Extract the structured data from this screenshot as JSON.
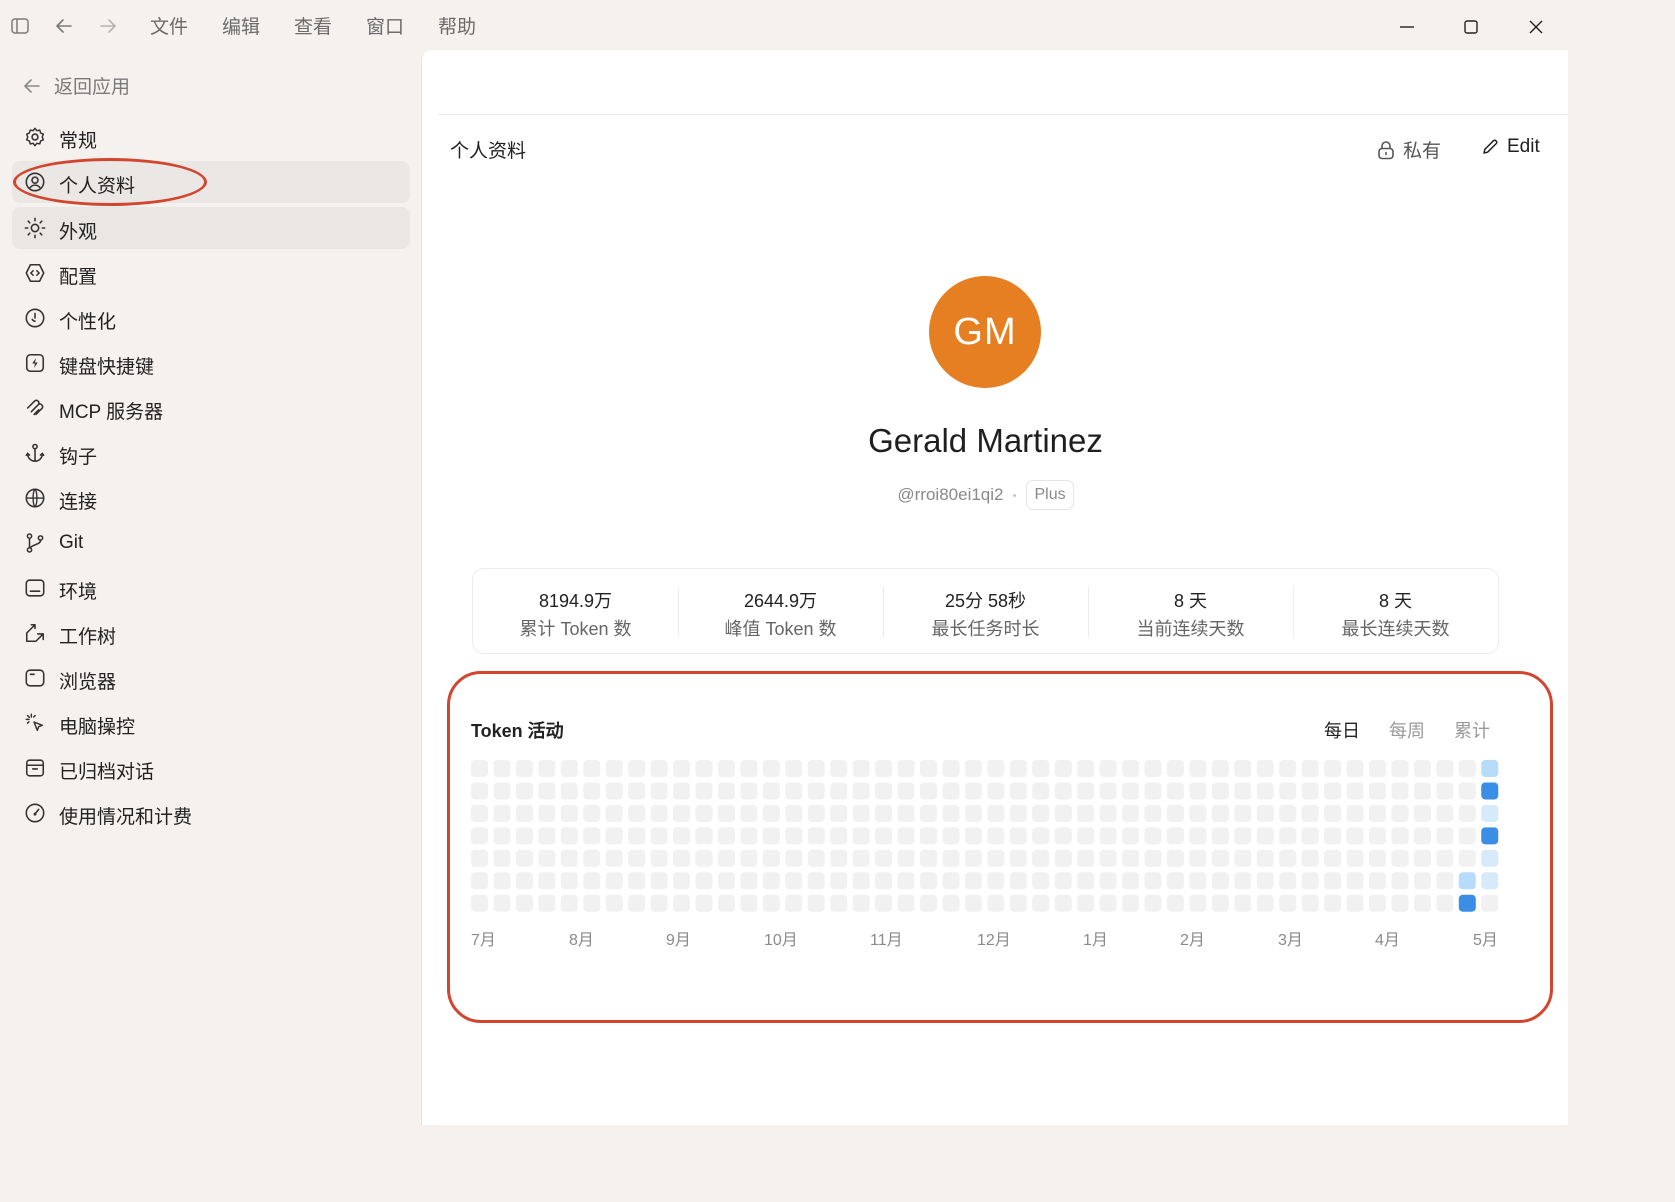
{
  "menu": [
    "文件",
    "编辑",
    "查看",
    "窗口",
    "帮助"
  ],
  "sidebar": {
    "back_label": "返回应用",
    "items": [
      {
        "label": "常规",
        "icon": "gear-icon"
      },
      {
        "label": "个人资料",
        "icon": "user-circle-icon"
      },
      {
        "label": "外观",
        "icon": "sun-icon"
      },
      {
        "label": "配置",
        "icon": "shield-code-icon"
      },
      {
        "label": "个性化",
        "icon": "smile-icon"
      },
      {
        "label": "键盘快捷键",
        "icon": "bolt-square-icon"
      },
      {
        "label": "MCP 服务器",
        "icon": "mcp-icon"
      },
      {
        "label": "钩子",
        "icon": "anchor-icon"
      },
      {
        "label": "连接",
        "icon": "globe-icon"
      },
      {
        "label": "Git",
        "icon": "git-branch-icon"
      },
      {
        "label": "环境",
        "icon": "monitor-icon"
      },
      {
        "label": "工作树",
        "icon": "worktree-icon"
      },
      {
        "label": "浏览器",
        "icon": "browser-icon"
      },
      {
        "label": "电脑操控",
        "icon": "cursor-click-icon"
      },
      {
        "label": "已归档对话",
        "icon": "archive-icon"
      },
      {
        "label": "使用情况和计费",
        "icon": "gauge-icon"
      }
    ]
  },
  "page": {
    "title": "个人资料",
    "private_label": "私有",
    "edit_label": "Edit"
  },
  "profile": {
    "initials": "GM",
    "name": "Gerald Martinez",
    "handle": "@rroi80ei1qi2",
    "plan": "Plus",
    "avatar_color": "#e67e22"
  },
  "stats": [
    {
      "value": "8194.9万",
      "label": "累计 Token 数"
    },
    {
      "value": "2644.9万",
      "label": "峰值 Token 数"
    },
    {
      "value": "25分 58秒",
      "label": "最长任务时长"
    },
    {
      "value": "8 天",
      "label": "当前连续天数"
    },
    {
      "value": "8 天",
      "label": "最长连续天数"
    }
  ],
  "activity": {
    "title": "Token 活动",
    "tabs": [
      {
        "label": "每日",
        "active": true
      },
      {
        "label": "每周",
        "active": false
      },
      {
        "label": "累计",
        "active": false
      }
    ],
    "months": [
      "7月",
      "8月",
      "9月",
      "10月",
      "11月",
      "12月",
      "1月",
      "2月",
      "3月",
      "4月",
      "5月"
    ],
    "weeks": 46,
    "colors": {
      "empty": "#f1f1f1",
      "low": "#d6eafc",
      "mid": "#b7dbfb",
      "high": "#3a8ee6"
    },
    "active_cells": [
      {
        "week": 45,
        "day": 0,
        "level": "mid"
      },
      {
        "week": 45,
        "day": 1,
        "level": "high"
      },
      {
        "week": 45,
        "day": 2,
        "level": "low"
      },
      {
        "week": 45,
        "day": 3,
        "level": "high"
      },
      {
        "week": 45,
        "day": 4,
        "level": "low"
      },
      {
        "week": 44,
        "day": 5,
        "level": "mid"
      },
      {
        "week": 45,
        "day": 5,
        "level": "low"
      },
      {
        "week": 44,
        "day": 6,
        "level": "high"
      }
    ]
  }
}
